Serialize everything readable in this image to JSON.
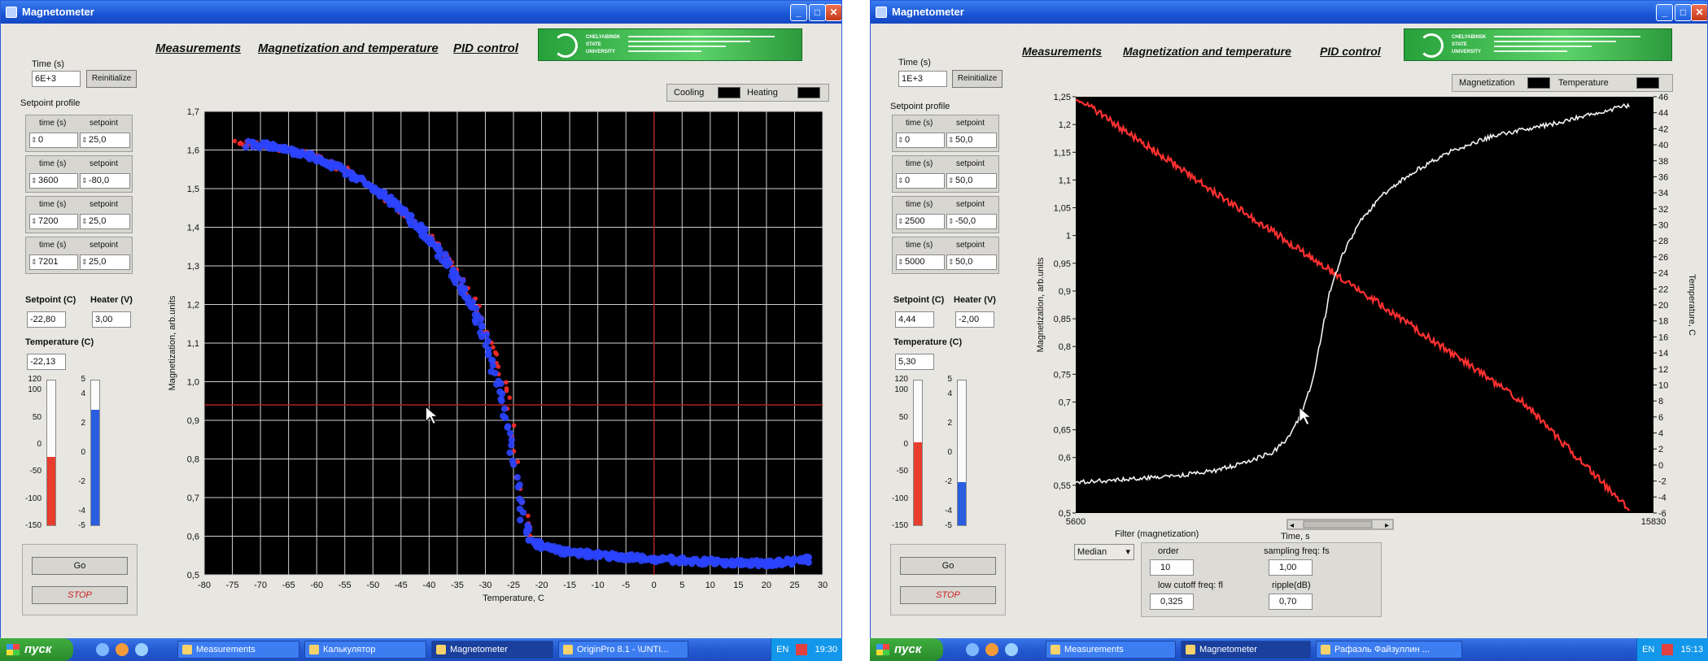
{
  "left": {
    "title": "Magnetometer",
    "tabs": [
      "Measurements",
      "Magnetization and temperature",
      "PID control"
    ],
    "time_label": "Time (s)",
    "time_value": "6E+3",
    "reinit_label": "Reinitialize",
    "setpoint_profile_label": "Setpoint profile",
    "profile_headers": {
      "time": "time (s)",
      "setpoint": "setpoint"
    },
    "profile_rows": [
      {
        "time": "0",
        "setpoint": "25,0"
      },
      {
        "time": "3600",
        "setpoint": "-80,0"
      },
      {
        "time": "7200",
        "setpoint": "25,0"
      },
      {
        "time": "7201",
        "setpoint": "25,0"
      }
    ],
    "setpoint_label": "Setpoint (C)",
    "setpoint_value": "-22,80",
    "heater_label": "Heater (V)",
    "heater_value": "3,00",
    "temperature_label": "Temperature (C)",
    "temperature_value": "-22,13",
    "gauge_temp_ticks": [
      "120",
      "100",
      "50",
      "0",
      "-50",
      "-100",
      "-150"
    ],
    "gauge_temp_level": -22.13,
    "gauge_heater_ticks": [
      "5",
      "4",
      "2",
      "0",
      "-2",
      "-4",
      "-5"
    ],
    "gauge_heater_level": 3.0,
    "go_label": "Go",
    "stop_label": "STOP",
    "legend": {
      "cooling": "Cooling",
      "heating": "Heating"
    },
    "colors": {
      "cooling": "#2b44ff",
      "heating": "#ff2b2b",
      "cursor": "#b02020"
    }
  },
  "right": {
    "title": "Magnetometer",
    "tabs": [
      "Measurements",
      "Magnetization and temperature",
      "PID control"
    ],
    "time_label": "Time (s)",
    "time_value": "1E+3",
    "reinit_label": "Reinitialize",
    "setpoint_profile_label": "Setpoint profile",
    "profile_headers": {
      "time": "time (s)",
      "setpoint": "setpoint"
    },
    "profile_rows": [
      {
        "time": "0",
        "setpoint": "50,0"
      },
      {
        "time": "0",
        "setpoint": "50,0"
      },
      {
        "time": "2500",
        "setpoint": "-50,0"
      },
      {
        "time": "5000",
        "setpoint": "50,0"
      }
    ],
    "setpoint_label": "Setpoint (C)",
    "setpoint_value": "4,44",
    "heater_label": "Heater (V)",
    "heater_value": "-2,00",
    "temperature_label": "Temperature (C)",
    "temperature_value": "5,30",
    "gauge_temp_ticks": [
      "120",
      "100",
      "50",
      "0",
      "-50",
      "-100",
      "-150"
    ],
    "gauge_temp_level": 5.3,
    "gauge_heater_ticks": [
      "5",
      "4",
      "2",
      "0",
      "-2",
      "-4",
      "-5"
    ],
    "gauge_heater_level": -2.0,
    "go_label": "Go",
    "stop_label": "STOP",
    "legend": {
      "magnetization": "Magnetization",
      "temperature": "Temperature"
    },
    "filter": {
      "label": "Filter (magnetization)",
      "type": "Median",
      "order_label": "order",
      "order_value": "10",
      "sampling_label": "sampling freq: fs",
      "sampling_value": "1,00",
      "low_cutoff_label": "low cutoff freq: fl",
      "low_cutoff_value": "0,325",
      "ripple_label": "ripple(dB)",
      "ripple_value": "0,70"
    },
    "colors": {
      "magnetization": "#f2f2f2",
      "temperature": "#ff3030"
    }
  },
  "taskbar_left": {
    "start_label": "пуск",
    "items": [
      "Measurements",
      "Калькулятор",
      "Magnetometer",
      "OriginPro 8.1 - \\UNTI..."
    ],
    "active": 2,
    "lang": "EN",
    "time": "19:30"
  },
  "taskbar_right": {
    "start_label": "пуск",
    "items": [
      "Measurements",
      "Magnetometer",
      "Рафаэль Файзуллин ..."
    ],
    "active": 1,
    "lang": "EN",
    "time": "15:13"
  },
  "chart_data": [
    {
      "type": "scatter",
      "title": "",
      "xlabel": "Temperature, C",
      "ylabel": "Magnetization, arb.units",
      "xlim": [
        -80,
        30
      ],
      "ylim": [
        0.5,
        1.7
      ],
      "xticks": [
        -80,
        -75,
        -70,
        -65,
        -60,
        -55,
        -50,
        -45,
        -40,
        -35,
        -30,
        -25,
        -20,
        -15,
        -10,
        -5,
        0,
        5,
        10,
        15,
        20,
        25,
        30
      ],
      "yticks": [
        "0,5",
        "0,6",
        "0,7",
        "0,8",
        "0,9",
        "1,0",
        "1,1",
        "1,2",
        "1,3",
        "1,4",
        "1,5",
        "1,6",
        "1,7"
      ],
      "grid": true,
      "legend": "top-right",
      "series": [
        {
          "name": "Cooling",
          "x": [
            -72,
            -68,
            -64,
            -60,
            -56,
            -52,
            -48,
            -44,
            -40,
            -37,
            -34,
            -31,
            -29,
            -27,
            -26,
            -25,
            -24,
            -23,
            -22,
            -20,
            -16,
            -10,
            -4,
            2,
            8,
            14,
            20,
            25,
            28
          ],
          "y": [
            1.615,
            1.61,
            1.595,
            1.58,
            1.555,
            1.52,
            1.48,
            1.43,
            1.37,
            1.31,
            1.24,
            1.15,
            1.06,
            0.95,
            0.88,
            0.8,
            0.7,
            0.63,
            0.59,
            0.575,
            0.56,
            0.55,
            0.545,
            0.54,
            0.535,
            0.53,
            0.53,
            0.535,
            0.54
          ]
        },
        {
          "name": "Heating",
          "x": [
            -74,
            -70,
            -66,
            -62,
            -58,
            -54,
            -50,
            -46,
            -42,
            -38,
            -34,
            -31,
            -28,
            -26,
            -25,
            -24,
            -23,
            -22
          ],
          "y": [
            1.62,
            1.615,
            1.605,
            1.59,
            1.57,
            1.54,
            1.5,
            1.46,
            1.4,
            1.34,
            1.26,
            1.18,
            1.06,
            0.96,
            0.87,
            0.76,
            0.66,
            0.6
          ]
        }
      ],
      "cursor": {
        "x": 0,
        "y": 0.94
      }
    },
    {
      "type": "line",
      "title": "",
      "xlabel": "Time, s",
      "ylabel": "Magnetization, arb.units",
      "y2label": "Temperature, C",
      "xlim": [
        5600,
        15830
      ],
      "ylim": [
        0.5,
        1.25
      ],
      "y2lim": [
        -6,
        46
      ],
      "xticks": [
        "5600",
        "15830"
      ],
      "yticks": [
        "0,5",
        "0,55",
        "0,6",
        "0,65",
        "0,7",
        "0,75",
        "0,8",
        "0,85",
        "0,9",
        "0,95",
        "1",
        "1,05",
        "1,1",
        "1,15",
        "1,2",
        "1,25"
      ],
      "y2ticks": [
        "-6",
        "-4",
        "-2",
        "0",
        "2",
        "4",
        "6",
        "8",
        "10",
        "12",
        "14",
        "16",
        "18",
        "20",
        "22",
        "24",
        "26",
        "28",
        "30",
        "32",
        "34",
        "36",
        "38",
        "40",
        "42",
        "44",
        "46"
      ],
      "grid": false,
      "legend": "top-right",
      "series": [
        {
          "name": "Magnetization",
          "axis": "left",
          "x": [
            5600,
            6400,
            7200,
            8000,
            8600,
            9100,
            9400,
            9600,
            9800,
            9950,
            10100,
            10300,
            10600,
            11000,
            11500,
            12200,
            13000,
            14000,
            15000,
            15400
          ],
          "y": [
            0.555,
            0.56,
            0.565,
            0.575,
            0.59,
            0.61,
            0.64,
            0.68,
            0.74,
            0.82,
            0.9,
            0.96,
            1.02,
            1.07,
            1.11,
            1.15,
            1.18,
            1.2,
            1.225,
            1.235
          ]
        },
        {
          "name": "Temperature",
          "axis": "right",
          "x": [
            5600,
            6500,
            7500,
            8500,
            9500,
            10500,
            11500,
            12500,
            13500,
            14500,
            15400
          ],
          "y": [
            46.0,
            41.6,
            36.8,
            32.0,
            27.2,
            22.4,
            17.6,
            12.8,
            8.0,
            0.8,
            -5.5
          ]
        }
      ]
    }
  ]
}
